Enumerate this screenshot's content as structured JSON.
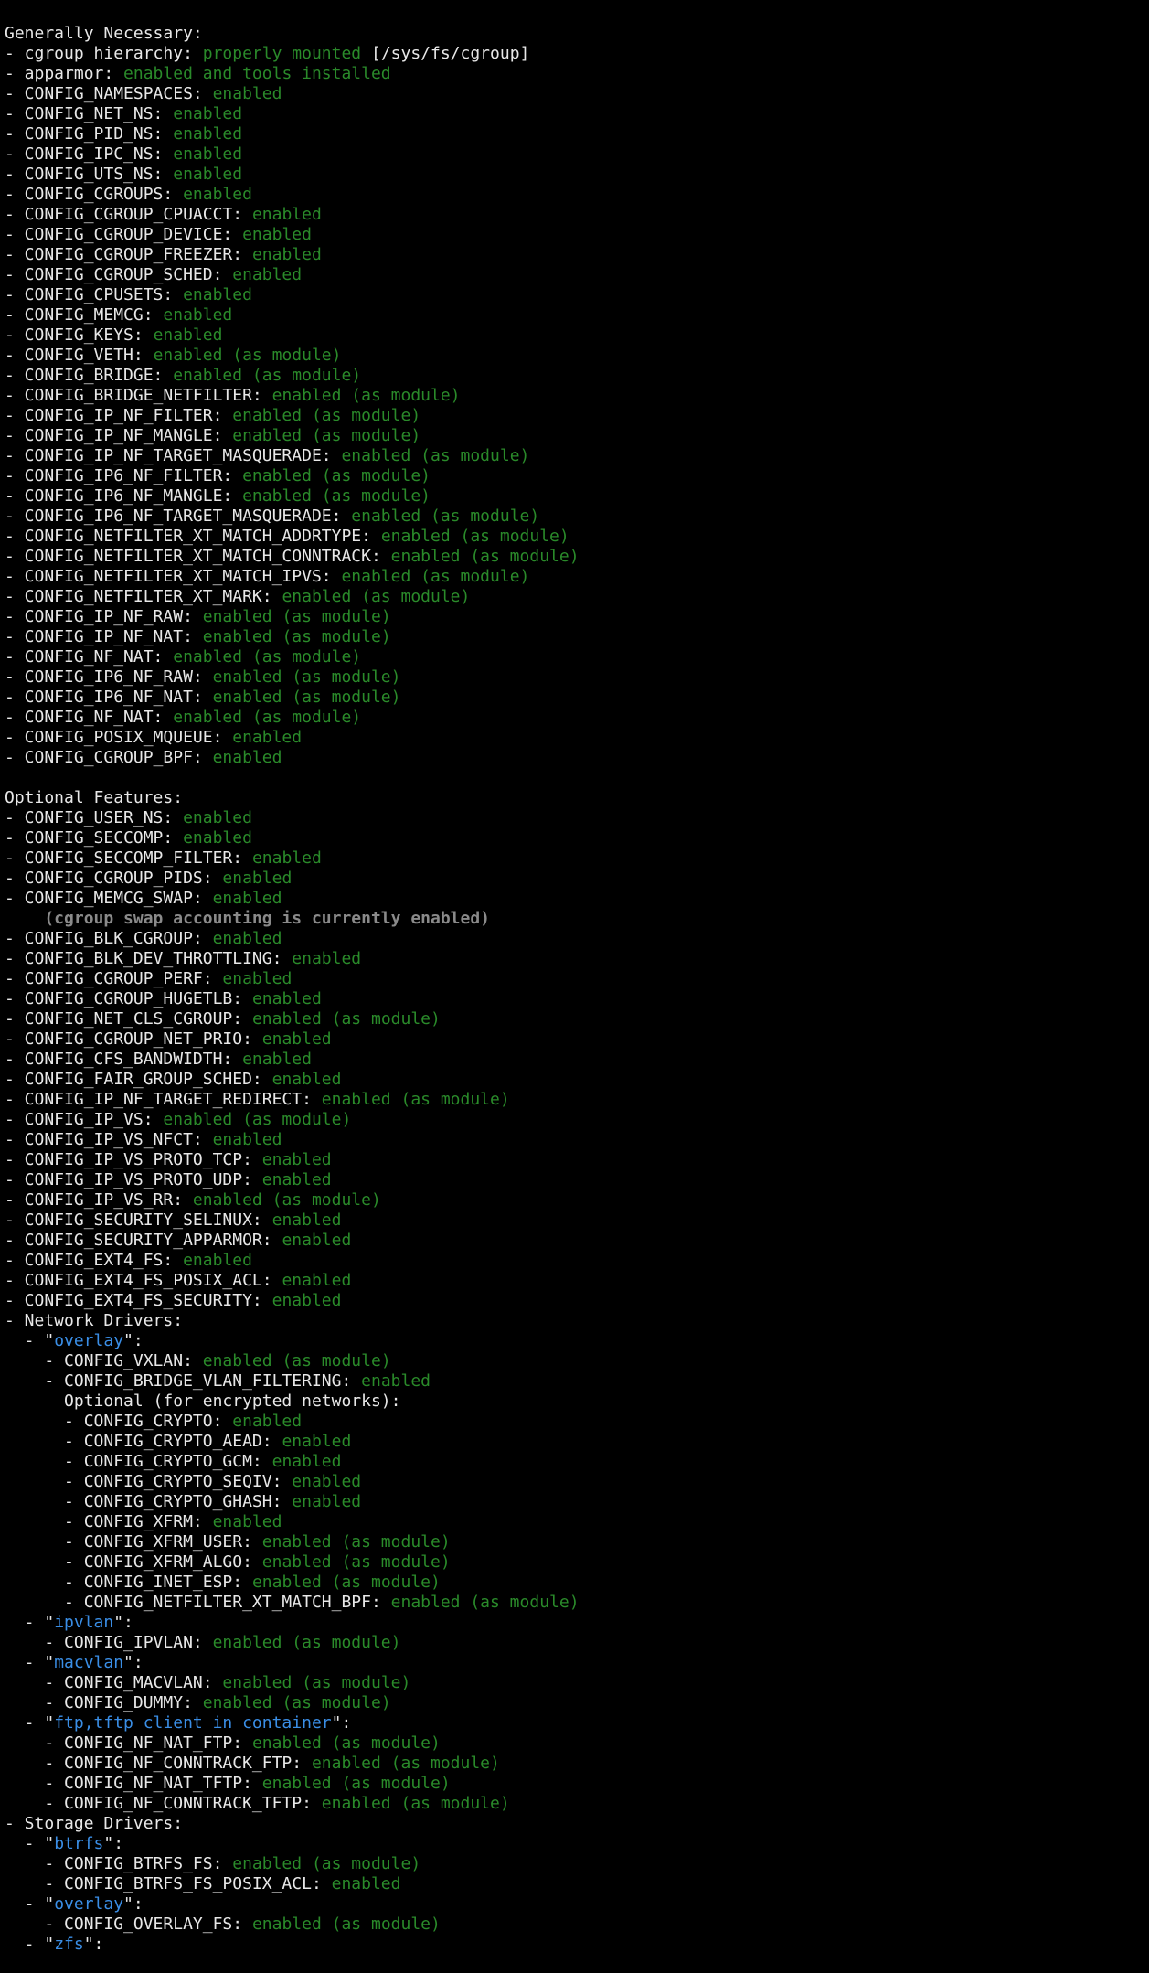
{
  "colors": {
    "background": "#000000",
    "text": "#e8e8e8",
    "enabled": "#2a8a2a",
    "driver_name": "#3a8ee6",
    "note": "#8a8a8a"
  },
  "lines": [
    [
      [
        "w",
        "Generally Necessary:"
      ]
    ],
    [
      [
        "w",
        "- cgroup hierarchy: "
      ],
      [
        "g",
        "properly mounted"
      ],
      [
        "w",
        " [/sys/fs/cgroup]"
      ]
    ],
    [
      [
        "w",
        "- apparmor: "
      ],
      [
        "g",
        "enabled and tools installed"
      ]
    ],
    [
      [
        "w",
        "- CONFIG_NAMESPACES: "
      ],
      [
        "g",
        "enabled"
      ]
    ],
    [
      [
        "w",
        "- CONFIG_NET_NS: "
      ],
      [
        "g",
        "enabled"
      ]
    ],
    [
      [
        "w",
        "- CONFIG_PID_NS: "
      ],
      [
        "g",
        "enabled"
      ]
    ],
    [
      [
        "w",
        "- CONFIG_IPC_NS: "
      ],
      [
        "g",
        "enabled"
      ]
    ],
    [
      [
        "w",
        "- CONFIG_UTS_NS: "
      ],
      [
        "g",
        "enabled"
      ]
    ],
    [
      [
        "w",
        "- CONFIG_CGROUPS: "
      ],
      [
        "g",
        "enabled"
      ]
    ],
    [
      [
        "w",
        "- CONFIG_CGROUP_CPUACCT: "
      ],
      [
        "g",
        "enabled"
      ]
    ],
    [
      [
        "w",
        "- CONFIG_CGROUP_DEVICE: "
      ],
      [
        "g",
        "enabled"
      ]
    ],
    [
      [
        "w",
        "- CONFIG_CGROUP_FREEZER: "
      ],
      [
        "g",
        "enabled"
      ]
    ],
    [
      [
        "w",
        "- CONFIG_CGROUP_SCHED: "
      ],
      [
        "g",
        "enabled"
      ]
    ],
    [
      [
        "w",
        "- CONFIG_CPUSETS: "
      ],
      [
        "g",
        "enabled"
      ]
    ],
    [
      [
        "w",
        "- CONFIG_MEMCG: "
      ],
      [
        "g",
        "enabled"
      ]
    ],
    [
      [
        "w",
        "- CONFIG_KEYS: "
      ],
      [
        "g",
        "enabled"
      ]
    ],
    [
      [
        "w",
        "- CONFIG_VETH: "
      ],
      [
        "g",
        "enabled (as module)"
      ]
    ],
    [
      [
        "w",
        "- CONFIG_BRIDGE: "
      ],
      [
        "g",
        "enabled (as module)"
      ]
    ],
    [
      [
        "w",
        "- CONFIG_BRIDGE_NETFILTER: "
      ],
      [
        "g",
        "enabled (as module)"
      ]
    ],
    [
      [
        "w",
        "- CONFIG_IP_NF_FILTER: "
      ],
      [
        "g",
        "enabled (as module)"
      ]
    ],
    [
      [
        "w",
        "- CONFIG_IP_NF_MANGLE: "
      ],
      [
        "g",
        "enabled (as module)"
      ]
    ],
    [
      [
        "w",
        "- CONFIG_IP_NF_TARGET_MASQUERADE: "
      ],
      [
        "g",
        "enabled (as module)"
      ]
    ],
    [
      [
        "w",
        "- CONFIG_IP6_NF_FILTER: "
      ],
      [
        "g",
        "enabled (as module)"
      ]
    ],
    [
      [
        "w",
        "- CONFIG_IP6_NF_MANGLE: "
      ],
      [
        "g",
        "enabled (as module)"
      ]
    ],
    [
      [
        "w",
        "- CONFIG_IP6_NF_TARGET_MASQUERADE: "
      ],
      [
        "g",
        "enabled (as module)"
      ]
    ],
    [
      [
        "w",
        "- CONFIG_NETFILTER_XT_MATCH_ADDRTYPE: "
      ],
      [
        "g",
        "enabled (as module)"
      ]
    ],
    [
      [
        "w",
        "- CONFIG_NETFILTER_XT_MATCH_CONNTRACK: "
      ],
      [
        "g",
        "enabled (as module)"
      ]
    ],
    [
      [
        "w",
        "- CONFIG_NETFILTER_XT_MATCH_IPVS: "
      ],
      [
        "g",
        "enabled (as module)"
      ]
    ],
    [
      [
        "w",
        "- CONFIG_NETFILTER_XT_MARK: "
      ],
      [
        "g",
        "enabled (as module)"
      ]
    ],
    [
      [
        "w",
        "- CONFIG_IP_NF_RAW: "
      ],
      [
        "g",
        "enabled (as module)"
      ]
    ],
    [
      [
        "w",
        "- CONFIG_IP_NF_NAT: "
      ],
      [
        "g",
        "enabled (as module)"
      ]
    ],
    [
      [
        "w",
        "- CONFIG_NF_NAT: "
      ],
      [
        "g",
        "enabled (as module)"
      ]
    ],
    [
      [
        "w",
        "- CONFIG_IP6_NF_RAW: "
      ],
      [
        "g",
        "enabled (as module)"
      ]
    ],
    [
      [
        "w",
        "- CONFIG_IP6_NF_NAT: "
      ],
      [
        "g",
        "enabled (as module)"
      ]
    ],
    [
      [
        "w",
        "- CONFIG_NF_NAT: "
      ],
      [
        "g",
        "enabled (as module)"
      ]
    ],
    [
      [
        "w",
        "- CONFIG_POSIX_MQUEUE: "
      ],
      [
        "g",
        "enabled"
      ]
    ],
    [
      [
        "w",
        "- CONFIG_CGROUP_BPF: "
      ],
      [
        "g",
        "enabled"
      ]
    ],
    [],
    [
      [
        "w",
        "Optional Features:"
      ]
    ],
    [
      [
        "w",
        "- CONFIG_USER_NS: "
      ],
      [
        "g",
        "enabled"
      ]
    ],
    [
      [
        "w",
        "- CONFIG_SECCOMP: "
      ],
      [
        "g",
        "enabled"
      ]
    ],
    [
      [
        "w",
        "- CONFIG_SECCOMP_FILTER: "
      ],
      [
        "g",
        "enabled"
      ]
    ],
    [
      [
        "w",
        "- CONFIG_CGROUP_PIDS: "
      ],
      [
        "g",
        "enabled"
      ]
    ],
    [
      [
        "w",
        "- CONFIG_MEMCG_SWAP: "
      ],
      [
        "g",
        "enabled"
      ]
    ],
    [
      [
        "n",
        "    (cgroup swap accounting is currently enabled)"
      ]
    ],
    [
      [
        "w",
        "- CONFIG_BLK_CGROUP: "
      ],
      [
        "g",
        "enabled"
      ]
    ],
    [
      [
        "w",
        "- CONFIG_BLK_DEV_THROTTLING: "
      ],
      [
        "g",
        "enabled"
      ]
    ],
    [
      [
        "w",
        "- CONFIG_CGROUP_PERF: "
      ],
      [
        "g",
        "enabled"
      ]
    ],
    [
      [
        "w",
        "- CONFIG_CGROUP_HUGETLB: "
      ],
      [
        "g",
        "enabled"
      ]
    ],
    [
      [
        "w",
        "- CONFIG_NET_CLS_CGROUP: "
      ],
      [
        "g",
        "enabled (as module)"
      ]
    ],
    [
      [
        "w",
        "- CONFIG_CGROUP_NET_PRIO: "
      ],
      [
        "g",
        "enabled"
      ]
    ],
    [
      [
        "w",
        "- CONFIG_CFS_BANDWIDTH: "
      ],
      [
        "g",
        "enabled"
      ]
    ],
    [
      [
        "w",
        "- CONFIG_FAIR_GROUP_SCHED: "
      ],
      [
        "g",
        "enabled"
      ]
    ],
    [
      [
        "w",
        "- CONFIG_IP_NF_TARGET_REDIRECT: "
      ],
      [
        "g",
        "enabled (as module)"
      ]
    ],
    [
      [
        "w",
        "- CONFIG_IP_VS: "
      ],
      [
        "g",
        "enabled (as module)"
      ]
    ],
    [
      [
        "w",
        "- CONFIG_IP_VS_NFCT: "
      ],
      [
        "g",
        "enabled"
      ]
    ],
    [
      [
        "w",
        "- CONFIG_IP_VS_PROTO_TCP: "
      ],
      [
        "g",
        "enabled"
      ]
    ],
    [
      [
        "w",
        "- CONFIG_IP_VS_PROTO_UDP: "
      ],
      [
        "g",
        "enabled"
      ]
    ],
    [
      [
        "w",
        "- CONFIG_IP_VS_RR: "
      ],
      [
        "g",
        "enabled (as module)"
      ]
    ],
    [
      [
        "w",
        "- CONFIG_SECURITY_SELINUX: "
      ],
      [
        "g",
        "enabled"
      ]
    ],
    [
      [
        "w",
        "- CONFIG_SECURITY_APPARMOR: "
      ],
      [
        "g",
        "enabled"
      ]
    ],
    [
      [
        "w",
        "- CONFIG_EXT4_FS: "
      ],
      [
        "g",
        "enabled"
      ]
    ],
    [
      [
        "w",
        "- CONFIG_EXT4_FS_POSIX_ACL: "
      ],
      [
        "g",
        "enabled"
      ]
    ],
    [
      [
        "w",
        "- CONFIG_EXT4_FS_SECURITY: "
      ],
      [
        "g",
        "enabled"
      ]
    ],
    [
      [
        "w",
        "- Network Drivers:"
      ]
    ],
    [
      [
        "w",
        "  - \""
      ],
      [
        "b",
        "overlay"
      ],
      [
        "w",
        "\":"
      ]
    ],
    [
      [
        "w",
        "    - CONFIG_VXLAN: "
      ],
      [
        "g",
        "enabled (as module)"
      ]
    ],
    [
      [
        "w",
        "    - CONFIG_BRIDGE_VLAN_FILTERING: "
      ],
      [
        "g",
        "enabled"
      ]
    ],
    [
      [
        "w",
        "      Optional (for encrypted networks):"
      ]
    ],
    [
      [
        "w",
        "      - CONFIG_CRYPTO: "
      ],
      [
        "g",
        "enabled"
      ]
    ],
    [
      [
        "w",
        "      - CONFIG_CRYPTO_AEAD: "
      ],
      [
        "g",
        "enabled"
      ]
    ],
    [
      [
        "w",
        "      - CONFIG_CRYPTO_GCM: "
      ],
      [
        "g",
        "enabled"
      ]
    ],
    [
      [
        "w",
        "      - CONFIG_CRYPTO_SEQIV: "
      ],
      [
        "g",
        "enabled"
      ]
    ],
    [
      [
        "w",
        "      - CONFIG_CRYPTO_GHASH: "
      ],
      [
        "g",
        "enabled"
      ]
    ],
    [
      [
        "w",
        "      - CONFIG_XFRM: "
      ],
      [
        "g",
        "enabled"
      ]
    ],
    [
      [
        "w",
        "      - CONFIG_XFRM_USER: "
      ],
      [
        "g",
        "enabled (as module)"
      ]
    ],
    [
      [
        "w",
        "      - CONFIG_XFRM_ALGO: "
      ],
      [
        "g",
        "enabled (as module)"
      ]
    ],
    [
      [
        "w",
        "      - CONFIG_INET_ESP: "
      ],
      [
        "g",
        "enabled (as module)"
      ]
    ],
    [
      [
        "w",
        "      - CONFIG_NETFILTER_XT_MATCH_BPF: "
      ],
      [
        "g",
        "enabled (as module)"
      ]
    ],
    [
      [
        "w",
        "  - \""
      ],
      [
        "b",
        "ipvlan"
      ],
      [
        "w",
        "\":"
      ]
    ],
    [
      [
        "w",
        "    - CONFIG_IPVLAN: "
      ],
      [
        "g",
        "enabled (as module)"
      ]
    ],
    [
      [
        "w",
        "  - \""
      ],
      [
        "b",
        "macvlan"
      ],
      [
        "w",
        "\":"
      ]
    ],
    [
      [
        "w",
        "    - CONFIG_MACVLAN: "
      ],
      [
        "g",
        "enabled (as module)"
      ]
    ],
    [
      [
        "w",
        "    - CONFIG_DUMMY: "
      ],
      [
        "g",
        "enabled (as module)"
      ]
    ],
    [
      [
        "w",
        "  - \""
      ],
      [
        "b",
        "ftp,tftp client in container"
      ],
      [
        "w",
        "\":"
      ]
    ],
    [
      [
        "w",
        "    - CONFIG_NF_NAT_FTP: "
      ],
      [
        "g",
        "enabled (as module)"
      ]
    ],
    [
      [
        "w",
        "    - CONFIG_NF_CONNTRACK_FTP: "
      ],
      [
        "g",
        "enabled (as module)"
      ]
    ],
    [
      [
        "w",
        "    - CONFIG_NF_NAT_TFTP: "
      ],
      [
        "g",
        "enabled (as module)"
      ]
    ],
    [
      [
        "w",
        "    - CONFIG_NF_CONNTRACK_TFTP: "
      ],
      [
        "g",
        "enabled (as module)"
      ]
    ],
    [
      [
        "w",
        "- Storage Drivers:"
      ]
    ],
    [
      [
        "w",
        "  - \""
      ],
      [
        "b",
        "btrfs"
      ],
      [
        "w",
        "\":"
      ]
    ],
    [
      [
        "w",
        "    - CONFIG_BTRFS_FS: "
      ],
      [
        "g",
        "enabled (as module)"
      ]
    ],
    [
      [
        "w",
        "    - CONFIG_BTRFS_FS_POSIX_ACL: "
      ],
      [
        "g",
        "enabled"
      ]
    ],
    [
      [
        "w",
        "  - \""
      ],
      [
        "b",
        "overlay"
      ],
      [
        "w",
        "\":"
      ]
    ],
    [
      [
        "w",
        "    - CONFIG_OVERLAY_FS: "
      ],
      [
        "g",
        "enabled (as module)"
      ]
    ],
    [
      [
        "w",
        "  - \""
      ],
      [
        "b",
        "zfs"
      ],
      [
        "w",
        "\":"
      ]
    ]
  ]
}
